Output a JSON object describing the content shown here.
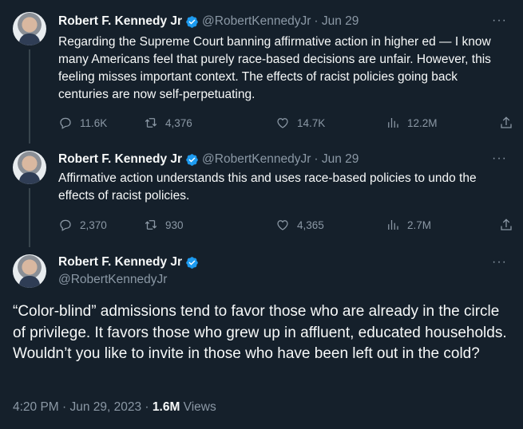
{
  "colors": {
    "background": "#15202b",
    "text": "#f7f9f9",
    "muted": "#8b98a5",
    "verified": "#1d9bf0"
  },
  "icons": [
    "reply-icon",
    "retweet-icon",
    "like-icon",
    "views-icon",
    "share-icon",
    "verified-badge-icon",
    "more-options-icon"
  ],
  "tweets": [
    {
      "author": "Robert F. Kennedy Jr",
      "handle": "@RobertKennedyJr",
      "date": "· Jun 29",
      "more": "···",
      "text": "Regarding the Supreme Court banning affirmative action in higher ed — I know many Americans feel that purely race-based decisions are unfair. However, this feeling misses important context. The effects of racist policies going back centuries are now self-perpetuating.",
      "replies": "11.6K",
      "retweets": "4,376",
      "likes": "14.7K",
      "views": "12.2M"
    },
    {
      "author": "Robert F. Kennedy Jr",
      "handle": "@RobertKennedyJr",
      "date": "· Jun 29",
      "more": "···",
      "text": "Affirmative action understands this and uses race-based policies to undo the effects of racist policies.",
      "replies": "2,370",
      "retweets": "930",
      "likes": "4,365",
      "views": "2.7M"
    }
  ],
  "main_tweet": {
    "author": "Robert F. Kennedy Jr",
    "handle": "@RobertKennedyJr",
    "more": "···",
    "text": "“Color-blind” admissions tend to favor those who are already in the circle of privilege. It favors those who grew up in affluent, educated households. Wouldn’t you like to invite in those who have been left out in the cold?",
    "timestamp": "4:20 PM · Jun 29, 2023 · ",
    "views_count": "1.6M",
    "views_label": " Views"
  }
}
